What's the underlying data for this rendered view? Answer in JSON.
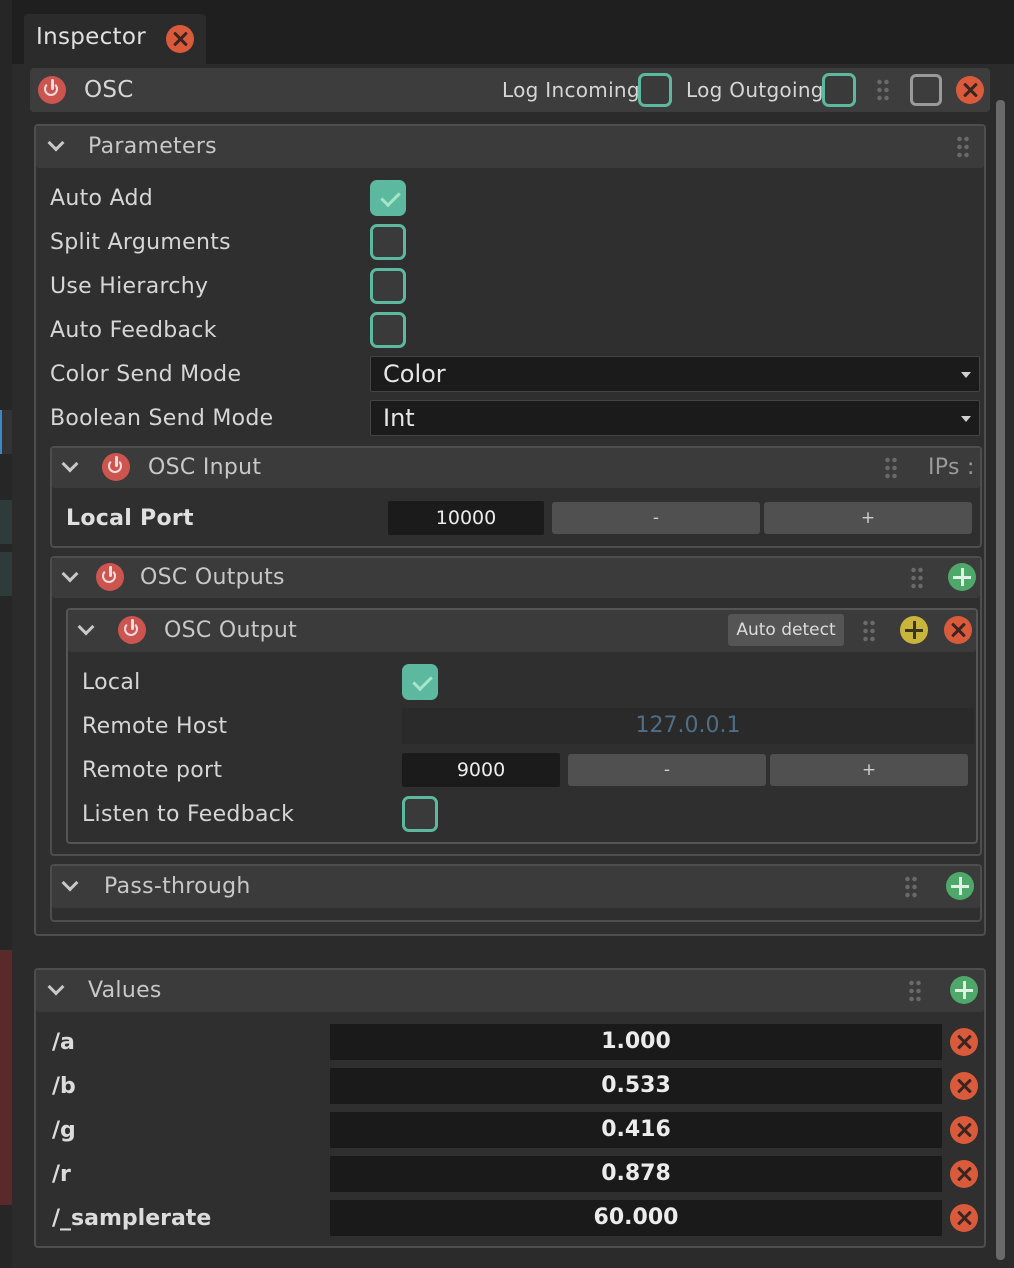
{
  "app": {
    "tab_label": "Inspector"
  },
  "module": {
    "title": "OSC",
    "log_incoming_label": "Log Incoming",
    "log_outgoing_label": "Log Outgoing"
  },
  "parameters": {
    "title": "Parameters",
    "auto_add_label": "Auto Add",
    "auto_add": true,
    "split_arguments_label": "Split Arguments",
    "split_arguments": false,
    "use_hierarchy_label": "Use Hierarchy",
    "use_hierarchy": false,
    "auto_feedback_label": "Auto Feedback",
    "auto_feedback": false,
    "color_send_mode_label": "Color Send Mode",
    "color_send_mode": "Color",
    "boolean_send_mode_label": "Boolean Send Mode",
    "boolean_send_mode": "Int"
  },
  "osc_input": {
    "title": "OSC Input",
    "ips_label": "IPs :",
    "local_port_label": "Local Port",
    "local_port": "10000",
    "minus": "-",
    "plus": "+"
  },
  "osc_outputs": {
    "title": "OSC Outputs",
    "output": {
      "title": "OSC Output",
      "auto_detect_label": "Auto detect",
      "local_label": "Local",
      "local": true,
      "remote_host_label": "Remote Host",
      "remote_host": "127.0.0.1",
      "remote_port_label": "Remote port",
      "remote_port": "9000",
      "minus": "-",
      "plus": "+",
      "listen_label": "Listen to Feedback",
      "listen": false
    }
  },
  "pass_through": {
    "title": "Pass-through"
  },
  "values": {
    "title": "Values",
    "items": [
      {
        "name": "/a",
        "value": "1.000"
      },
      {
        "name": "/b",
        "value": "0.533"
      },
      {
        "name": "/g",
        "value": "0.416"
      },
      {
        "name": "/r",
        "value": "0.878"
      },
      {
        "name": "/_samplerate",
        "value": "60.000"
      }
    ]
  },
  "colors": {
    "accent": "#5db8a0",
    "power": "#cc5550",
    "close": "#d95b3c",
    "add": "#4da86a"
  }
}
